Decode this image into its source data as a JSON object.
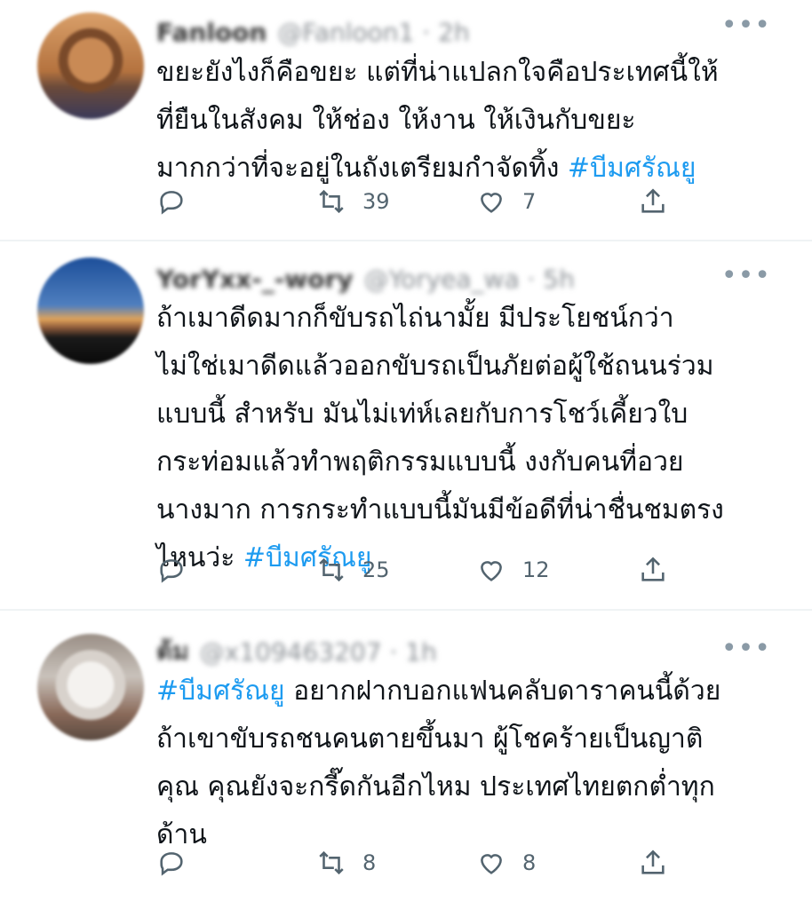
{
  "tweets": [
    {
      "name": "Fanloon",
      "handle": "@Fanloon1 · 2h",
      "text": "ขยะยังไงก็คือขยะ แต่ที่น่าแปลกใจคือประเทศนี้ให้\nที่ยืนในสังคม ให้ช่อง ให้งาน ให้เงินกับขยะ\nมากกว่าที่จะอยู่ในถังเตรียมกำจัดทิ้ง ",
      "hashtag": "#บีมศรัณยู",
      "retweets": "39",
      "likes": "7"
    },
    {
      "name": "YorYxx-_-wory",
      "handle": "@Yoryea_wa · 5h",
      "text": "ถ้าเมาดีดมากก็ขับรถไถ่นามั้ย มีประโยชน์กว่า\nไม่ใช่เมาดีดแล้วออกขับรถเป็นภัยต่อผู้ใช้ถนนร่วม\nแบบนี้ สำหรับ มันไม่เท่ห์เลยกับการโชว์เคี้ยวใบ\nกระท่อมแล้วทำพฤติกรรมแบบนี้ งงกับคนที่อวย\nนางมาก การกระทำแบบนี้มันมีข้อดีที่น่าชื่นชมตรง\nไหนว่ะ ",
      "hashtag": "#บีมศรัณยู",
      "retweets": "25",
      "likes": "12"
    },
    {
      "name": "ต้ม",
      "handle": "@x109463207 · 1h",
      "hashtag": "#บีมศรัณยู",
      "text": " อยากฝากบอกแฟนคลับดาราคนนี้ด้วย\nถ้าเขาขับรถชนคนตายขึ้นมา ผู้โชคร้ายเป็นญาติ\nคุณ คุณยังจะกรี๊ดกันอีกไหม ประเทศไทยตกต่ำทุก\nด้าน",
      "retweets": "8",
      "likes": "8"
    }
  ],
  "icons": {
    "more": "more-dots-icon",
    "reply": "reply-icon",
    "retweet": "retweet-icon",
    "like": "heart-icon",
    "share": "share-icon"
  },
  "colors": {
    "hashtag": "#1d9bf0",
    "divider": "#eff3f4",
    "icon": "#53646f"
  }
}
